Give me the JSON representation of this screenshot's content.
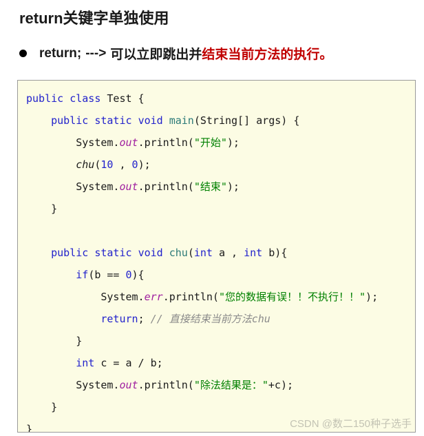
{
  "page": {
    "title": "return关键字单独使用",
    "background_color": "#ffffff"
  },
  "bullet": {
    "icon": "bullet-dot-icon",
    "keyword": "return;",
    "arrow": "--->",
    "text_black": "可以立即跳出并",
    "text_red": "结束当前方法的执行。",
    "red_color": "#c00000"
  },
  "code_block": {
    "background_color": "#fcfce4",
    "border_color": "#9a9a9a",
    "language": "java",
    "colors": {
      "keyword": "#2222cc",
      "string": "#008000",
      "number": "#2222cc",
      "field": "#a020a0",
      "method": "#2b7a78",
      "comment": "#8a8a8a",
      "plain": "#1a1a1a"
    },
    "lines": [
      [
        {
          "t": "public",
          "c": "t-kw"
        },
        {
          "t": " ",
          "c": "t-plain"
        },
        {
          "t": "class",
          "c": "t-kw"
        },
        {
          "t": " Test {",
          "c": "t-plain"
        }
      ],
      [
        {
          "t": "    ",
          "c": "t-plain"
        },
        {
          "t": "public",
          "c": "t-kw"
        },
        {
          "t": " ",
          "c": "t-plain"
        },
        {
          "t": "static",
          "c": "t-kw"
        },
        {
          "t": " ",
          "c": "t-plain"
        },
        {
          "t": "void",
          "c": "t-kw"
        },
        {
          "t": " ",
          "c": "t-plain"
        },
        {
          "t": "main",
          "c": "t-meth"
        },
        {
          "t": "(String[] args) {",
          "c": "t-plain"
        }
      ],
      [
        {
          "t": "        System.",
          "c": "t-plain"
        },
        {
          "t": "out",
          "c": "t-field"
        },
        {
          "t": ".println(",
          "c": "t-plain"
        },
        {
          "t": "\"开始\"",
          "c": "t-str"
        },
        {
          "t": ");",
          "c": "t-plain"
        }
      ],
      [
        {
          "t": "        ",
          "c": "t-plain"
        },
        {
          "t": "chu",
          "c": "t-call"
        },
        {
          "t": "(",
          "c": "t-plain"
        },
        {
          "t": "10",
          "c": "t-num"
        },
        {
          "t": " , ",
          "c": "t-plain"
        },
        {
          "t": "0",
          "c": "t-num"
        },
        {
          "t": ");",
          "c": "t-plain"
        }
      ],
      [
        {
          "t": "        System.",
          "c": "t-plain"
        },
        {
          "t": "out",
          "c": "t-field"
        },
        {
          "t": ".println(",
          "c": "t-plain"
        },
        {
          "t": "\"结束\"",
          "c": "t-str"
        },
        {
          "t": ");",
          "c": "t-plain"
        }
      ],
      [
        {
          "t": "    }",
          "c": "t-plain"
        }
      ],
      [
        {
          "t": "",
          "c": "t-plain"
        }
      ],
      [
        {
          "t": "    ",
          "c": "t-plain"
        },
        {
          "t": "public",
          "c": "t-kw"
        },
        {
          "t": " ",
          "c": "t-plain"
        },
        {
          "t": "static",
          "c": "t-kw"
        },
        {
          "t": " ",
          "c": "t-plain"
        },
        {
          "t": "void",
          "c": "t-kw"
        },
        {
          "t": " ",
          "c": "t-plain"
        },
        {
          "t": "chu",
          "c": "t-meth"
        },
        {
          "t": "(",
          "c": "t-plain"
        },
        {
          "t": "int",
          "c": "t-kw"
        },
        {
          "t": " a , ",
          "c": "t-plain"
        },
        {
          "t": "int",
          "c": "t-kw"
        },
        {
          "t": " b){",
          "c": "t-plain"
        }
      ],
      [
        {
          "t": "        ",
          "c": "t-plain"
        },
        {
          "t": "if",
          "c": "t-kw"
        },
        {
          "t": "(b == ",
          "c": "t-plain"
        },
        {
          "t": "0",
          "c": "t-num"
        },
        {
          "t": "){",
          "c": "t-plain"
        }
      ],
      [
        {
          "t": "            System.",
          "c": "t-plain"
        },
        {
          "t": "err",
          "c": "t-field"
        },
        {
          "t": ".println(",
          "c": "t-plain"
        },
        {
          "t": "\"您的数据有误！！不执行！！\"",
          "c": "t-str"
        },
        {
          "t": ");",
          "c": "t-plain"
        }
      ],
      [
        {
          "t": "            ",
          "c": "t-plain"
        },
        {
          "t": "return",
          "c": "t-kw"
        },
        {
          "t": "; ",
          "c": "t-plain"
        },
        {
          "t": "// 直接结束当前方法chu",
          "c": "t-cmt"
        }
      ],
      [
        {
          "t": "        }",
          "c": "t-plain"
        }
      ],
      [
        {
          "t": "        ",
          "c": "t-plain"
        },
        {
          "t": "int",
          "c": "t-kw"
        },
        {
          "t": " c = a / b;",
          "c": "t-plain"
        }
      ],
      [
        {
          "t": "        System.",
          "c": "t-plain"
        },
        {
          "t": "out",
          "c": "t-field"
        },
        {
          "t": ".println(",
          "c": "t-plain"
        },
        {
          "t": "\"除法结果是：\"",
          "c": "t-str"
        },
        {
          "t": "+c);",
          "c": "t-plain"
        }
      ],
      [
        {
          "t": "    }",
          "c": "t-plain"
        }
      ],
      [
        {
          "t": "}",
          "c": "t-plain"
        }
      ]
    ]
  },
  "watermark": {
    "text": "CSDN @数二150种子选手",
    "color": "#c3c3b4"
  }
}
